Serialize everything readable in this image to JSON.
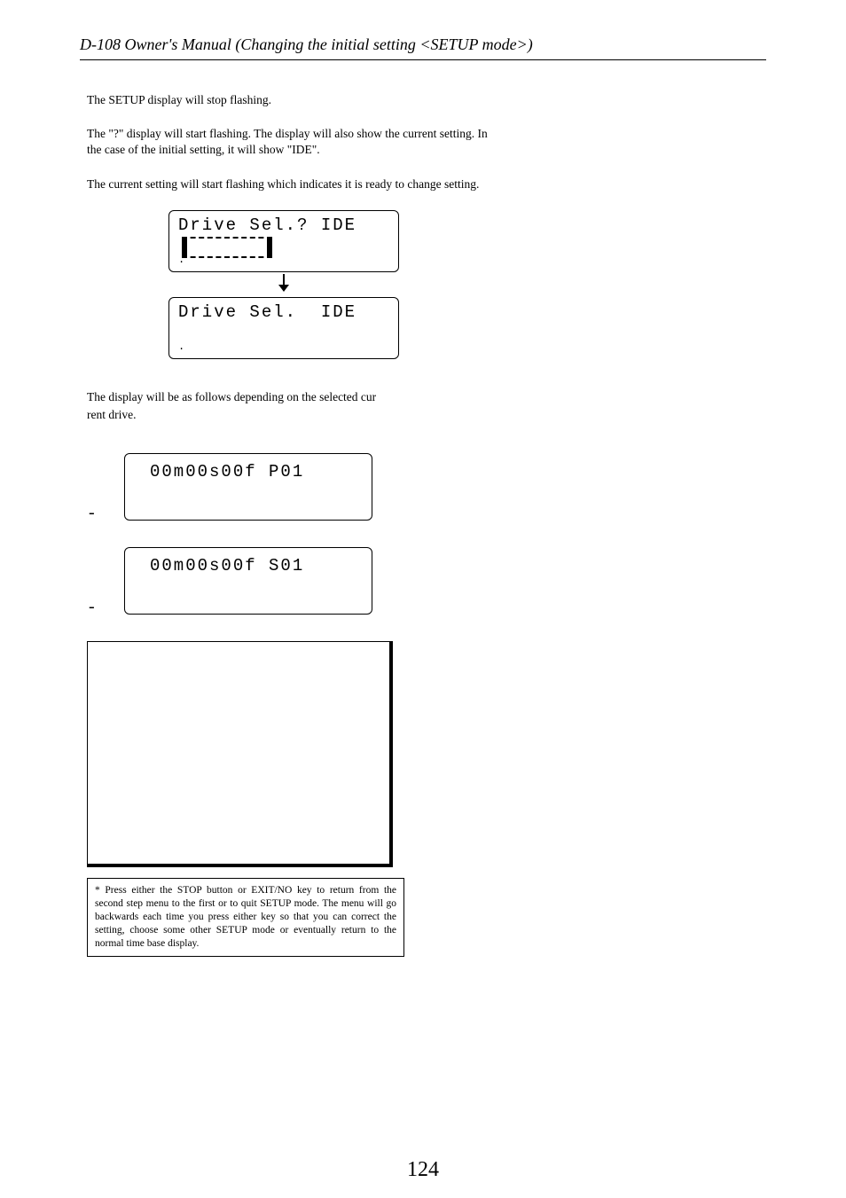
{
  "header": "D-108 Owner's Manual (Changing the initial setting <SETUP mode>)",
  "para1": "The SETUP display will stop flashing.",
  "para2": "The \"?\" display will start flashing.  The display will also show the current setting.  In the case of the initial setting, it will show \"IDE\".",
  "para3": "The current setting will start flashing which indicates it is ready to change setting.",
  "lcd_top_line1": "Drive Sel.? IDE",
  "lcd_top_line2": ".",
  "lcd_bottom_line1": "Drive Sel.  IDE",
  "lcd_bottom_line2": ".",
  "para4_a": "The display will be as follows depending on the selected cur",
  "para4_b": "rent drive.",
  "lcd_p01": "00m00s00f P01",
  "lcd_s01": "00m00s00f S01",
  "hyphen": "-",
  "note": "* Press either the STOP button or EXIT/NO key to return from the second step menu to the first or to quit SETUP mode. The menu will go backwards each time you press either key so that you can correct the setting, choose some other SETUP mode or eventually return to the normal time base display.",
  "page_number": "124"
}
